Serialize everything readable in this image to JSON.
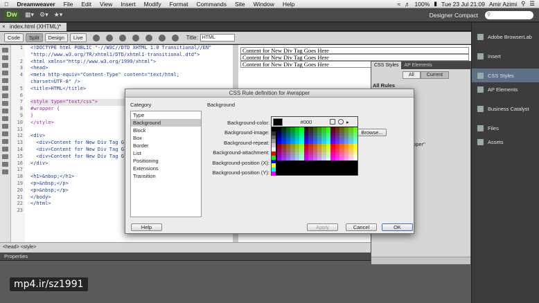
{
  "menubar": {
    "app_name": "Dreamweaver",
    "items": [
      "File",
      "Edit",
      "View",
      "Insert",
      "Modify",
      "Format",
      "Commands",
      "Site",
      "Window",
      "Help"
    ],
    "battery": "100%",
    "clock": "Tue 23 Jul  21:09",
    "user": "Amir Azimi"
  },
  "appbar": {
    "logo": "Dw",
    "workspace": "Designer Compact"
  },
  "document": {
    "tab_label": "index.html (XHTML)*",
    "views": [
      "Code",
      "Split",
      "Design",
      "Live"
    ],
    "title_label": "Title:",
    "title_value": "HTML"
  },
  "code": {
    "line_numbers": [
      "1",
      "2",
      "3",
      "4",
      "5",
      "6",
      "7",
      "8",
      "9",
      "10",
      "11",
      "12",
      "13",
      "14",
      "15",
      "16",
      "17",
      "18",
      "19",
      "20",
      "21",
      "22",
      "23"
    ],
    "lines": [
      "<!DOCTYPE html PUBLIC \"-//W3C//DTD XHTML 1.0 Transitional//EN\"",
      "\"http://www.w3.org/TR/xhtml1/DTD/xhtml1-transitional.dtd\">",
      "<html xmlns=\"http://www.w3.org/1999/xhtml\">",
      "<head>",
      "<meta http-equiv=\"Content-Type\" content=\"text/html;",
      "charset=UTF-8\" />",
      "<title>HTML</title>",
      "",
      "<style type=\"text/css\">",
      "#wrapper {",
      "}",
      "</style>",
      "",
      "<div>",
      "  <div>Content for New Div Tag G",
      "  <div>Content for New Div Tag G",
      "  <div>Content for New Div Tag G",
      "</div>",
      "",
      "<h1>&nbsp;</h1>",
      "<p>&nbsp;</p>",
      "<p>&nbsp;</p>",
      "</body>",
      "</html>"
    ]
  },
  "design": {
    "lines": [
      "Content for New Div Tag Goes Here",
      "Content for New Div Tag Goes Here",
      "Content for New Div Tag Goes Here"
    ]
  },
  "status_bar": {
    "tags": "<head> <style>"
  },
  "properties_label": "Properties",
  "css_panel": {
    "tabs": [
      "CSS Styles",
      "AP Elements"
    ],
    "modes": [
      "All",
      "Current"
    ],
    "all_rules": "All Rules",
    "rule_item": "apper\""
  },
  "right_dock": {
    "items": [
      "Adobe BrowserLab",
      "Insert",
      "CSS Styles",
      "AP Elements",
      "Business Catalyst",
      "Files",
      "Assets"
    ],
    "selected": "CSS Styles"
  },
  "dialog": {
    "title": "CSS Rule definition for #wrapper",
    "category_label": "Category",
    "section_label": "Background",
    "categories": [
      "Type",
      "Background",
      "Block",
      "Box",
      "Border",
      "List",
      "Positioning",
      "Extensions",
      "Transition"
    ],
    "selected_category": "Background",
    "fields": [
      "Background-color:",
      "Background-image:",
      "Background-repeat:",
      "Background-attachment:",
      "Background-position (X):",
      "Background-position (Y):"
    ],
    "browse": "Browse...",
    "help": "Help",
    "apply": "Apply",
    "cancel": "Cancel",
    "ok": "OK"
  },
  "color_picker": {
    "hex": "#000",
    "current_color": "#000000"
  },
  "watermark": "mp4.ir/sz1991"
}
